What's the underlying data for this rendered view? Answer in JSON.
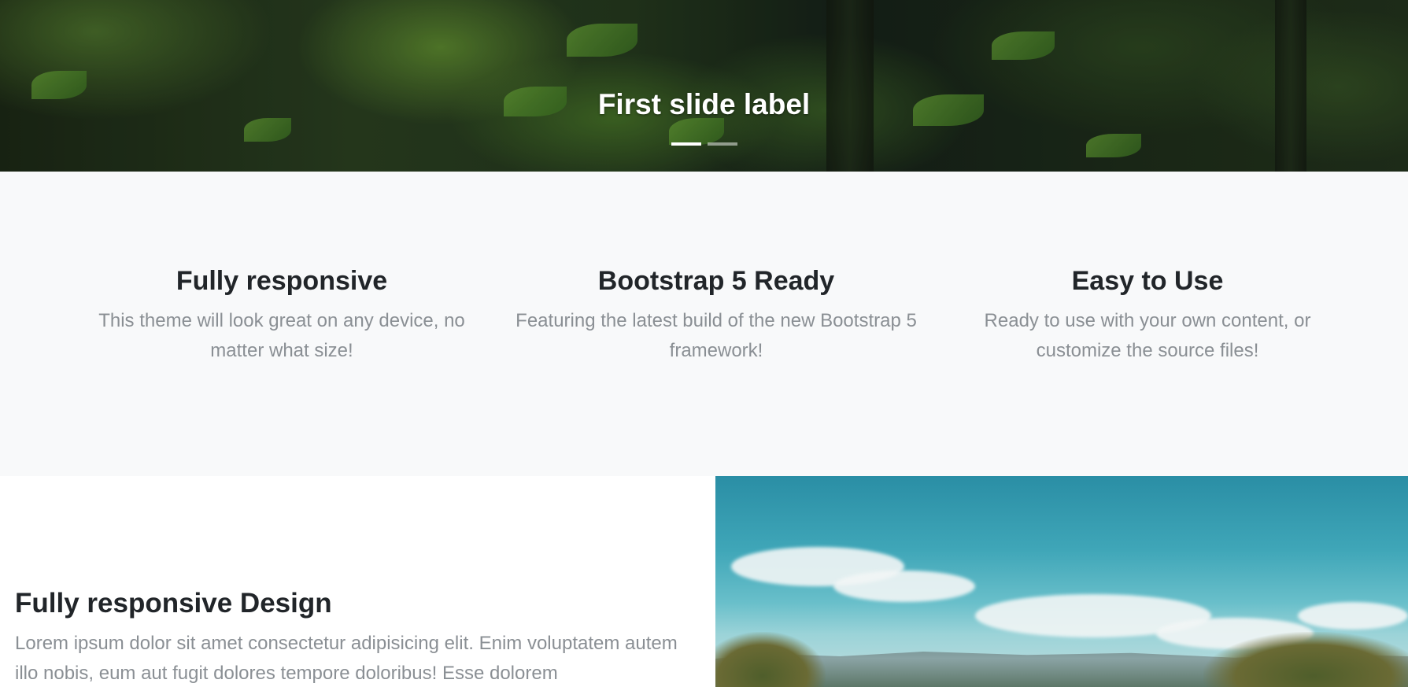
{
  "carousel": {
    "caption": "First slide label",
    "indicators": [
      {
        "label": "Slide 1",
        "active": true
      },
      {
        "label": "Slide 2",
        "active": false
      }
    ]
  },
  "features": [
    {
      "title": "Fully responsive",
      "text": "This theme will look great on any device, no matter what size!"
    },
    {
      "title": "Bootstrap 5 Ready",
      "text": "Featuring the latest build of the new Bootstrap 5 framework!"
    },
    {
      "title": "Easy to Use",
      "text": "Ready to use with your own content, or customize the source files!"
    }
  ],
  "showcase": {
    "title": "Fully responsive Design",
    "text": "Lorem ipsum dolor sit amet consectetur adipisicing elit. Enim voluptatem autem illo nobis, eum aut fugit dolores tempore doloribus! Esse dolorem"
  },
  "colors": {
    "features_background": "#f8f9fa",
    "heading_text": "#212529",
    "muted_text": "#8a8f94"
  }
}
